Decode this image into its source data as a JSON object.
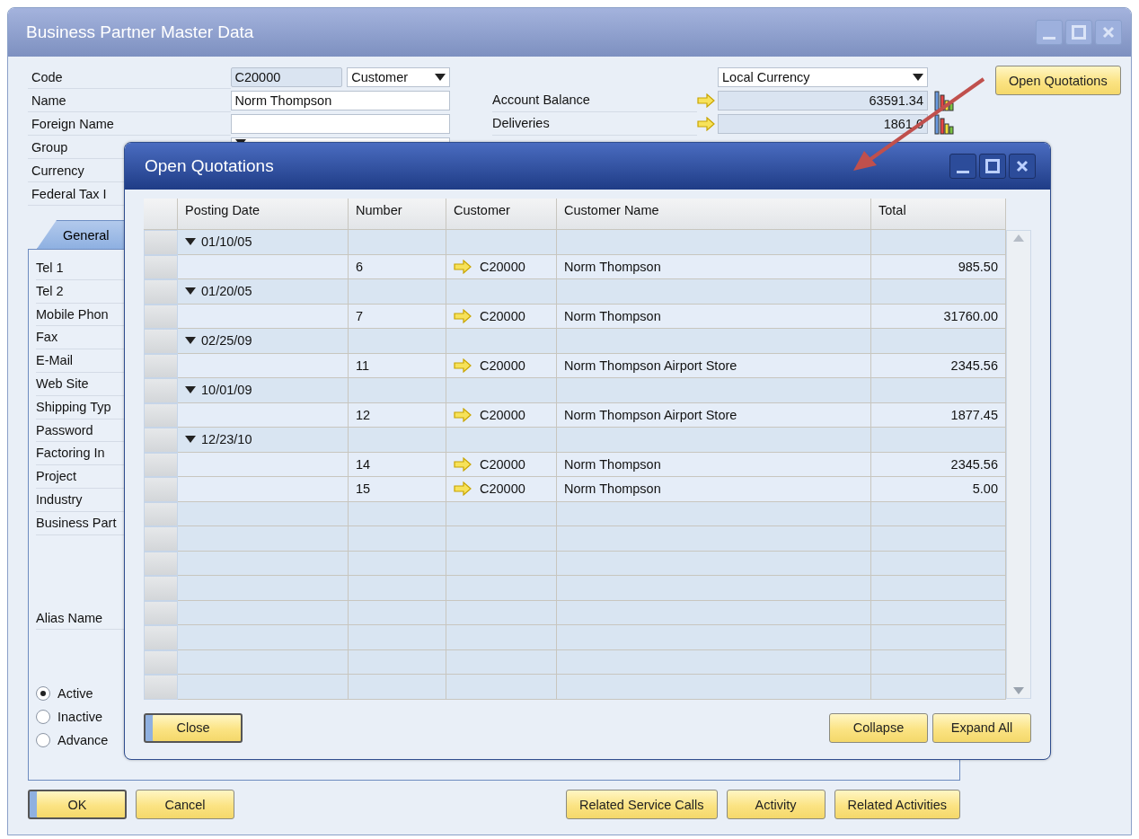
{
  "main_window": {
    "title": "Business Partner Master Data",
    "header_left": [
      {
        "label": "Code",
        "fields": [
          {
            "kind": "readonly",
            "value": "C20000"
          },
          {
            "kind": "dropdown",
            "value": "Customer"
          }
        ]
      },
      {
        "label": "Name",
        "fields": [
          {
            "kind": "text",
            "value": "Norm Thompson"
          }
        ]
      },
      {
        "label": "Foreign Name",
        "fields": [
          {
            "kind": "text"
          }
        ]
      },
      {
        "label": "Group",
        "fields": [
          {
            "kind": "dropdown"
          }
        ]
      },
      {
        "label": "Currency"
      },
      {
        "label": "Federal Tax I"
      }
    ],
    "currency_select": {
      "value": "Local Currency"
    },
    "balances": [
      {
        "label": "Account Balance",
        "value": "63591.34"
      },
      {
        "label": "Deliveries",
        "value": "1861.0"
      }
    ],
    "open_quotations_button": "Open Quotations",
    "tabs": [
      {
        "label": "General",
        "selected": true
      }
    ],
    "general_fields": [
      "Tel 1",
      "Tel 2",
      "Mobile Phon",
      "Fax",
      "E-Mail",
      "Web Site",
      "Shipping Typ",
      "Password",
      "Factoring In",
      "Project",
      "Industry",
      "Business Part"
    ],
    "alias_label": "Alias Name",
    "status_options": [
      {
        "label": "Active",
        "selected": true
      },
      {
        "label": "Inactive",
        "selected": false
      },
      {
        "label": "Advance",
        "selected": false
      }
    ],
    "left_buttons": [
      {
        "label": "OK",
        "default": true
      },
      {
        "label": "Cancel",
        "default": false
      }
    ],
    "right_buttons": [
      {
        "label": "Related Service Calls",
        "default": false
      },
      {
        "label": "Activity",
        "default": false
      },
      {
        "label": "Related Activities",
        "default": false
      }
    ]
  },
  "dialog": {
    "title": "Open Quotations",
    "columns": [
      "Posting Date",
      "Number",
      "Customer",
      "Customer Name",
      "Total"
    ],
    "groups": [
      {
        "date": "01/10/05",
        "expanded": true,
        "children": [
          {
            "number": "6",
            "customer": "C20000",
            "customer_name": "Norm Thompson",
            "total": "985.50"
          }
        ]
      },
      {
        "date": "01/20/05",
        "expanded": true,
        "children": [
          {
            "number": "7",
            "customer": "C20000",
            "customer_name": "Norm Thompson",
            "total": "31760.00"
          }
        ]
      },
      {
        "date": "02/25/09",
        "expanded": true,
        "children": [
          {
            "number": "11",
            "customer": "C20000",
            "customer_name": "Norm Thompson Airport Store",
            "total": "2345.56"
          }
        ]
      },
      {
        "date": "10/01/09",
        "expanded": true,
        "children": [
          {
            "number": "12",
            "customer": "C20000",
            "customer_name": "Norm Thompson Airport Store",
            "total": "1877.45"
          }
        ]
      },
      {
        "date": "12/23/10",
        "expanded": true,
        "children": [
          {
            "number": "14",
            "customer": "C20000",
            "customer_name": "Norm Thompson",
            "total": "2345.56"
          },
          {
            "number": "15",
            "customer": "C20000",
            "customer_name": "Norm Thompson",
            "total": "5.00"
          }
        ]
      }
    ],
    "left_buttons": [
      {
        "label": "Close",
        "default": true
      }
    ],
    "right_buttons": [
      {
        "label": "Collapse",
        "default": false
      },
      {
        "label": "Expand All",
        "default": false
      }
    ]
  }
}
